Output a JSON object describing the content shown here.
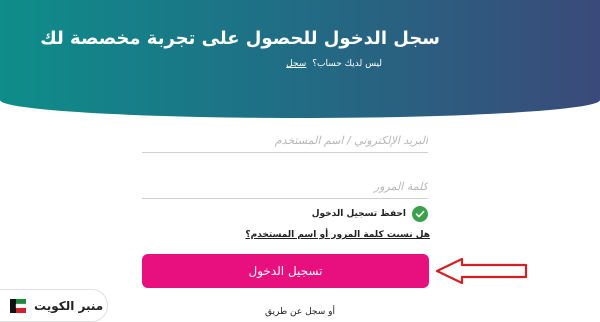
{
  "header": {
    "title": "سجل الدخول للحصول على تجربة مخصصة لك",
    "subtitle_prefix": "ليس لديك حساب؟",
    "subtitle_link": "سجل"
  },
  "form": {
    "username_placeholder": "البريد الإلكتروني / اسم المستخدم",
    "password_placeholder": "كلمة المرور",
    "remember_label": "احفظ تسجيل الدخول",
    "remember_checked": true,
    "forgot_link": "هل نسيت كلمة المرور أو اسم المستخدم؟",
    "login_button": "تسجيل الدخول",
    "or_text": "أو سجل عن طريق"
  },
  "watermark": {
    "text": "منبر الكويت"
  },
  "colors": {
    "header_start": "#0e8d8a",
    "header_end": "#3a4a7a",
    "button": "#e8107f",
    "check": "#3aa14a",
    "arrow": "#d42020"
  },
  "icons": {
    "check": "check-icon",
    "arrow": "arrow-left-icon",
    "logo": "kuwait-flag-logo-icon"
  }
}
